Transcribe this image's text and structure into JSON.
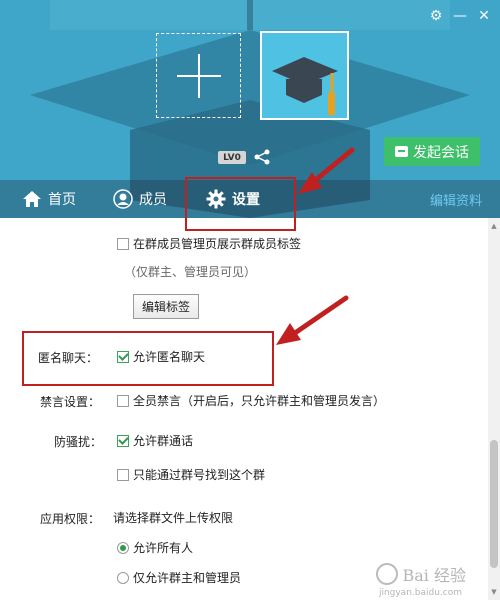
{
  "header": {
    "level_badge": "LV0",
    "start_chat_label": "发起会话",
    "colors": {
      "background": "#3fa6c9",
      "start_chat": "#3ec06a"
    }
  },
  "tabs": [
    {
      "label": "首页",
      "icon": "home-icon"
    },
    {
      "label": "成员",
      "icon": "user-icon"
    },
    {
      "label": "设置",
      "icon": "gear-icon",
      "active": true
    }
  ],
  "edit_profile_label": "编辑资料",
  "settings": {
    "show_member_tag_label": "在群成员管理页展示群成员标签",
    "show_member_tag_checked": false,
    "visibility_hint": "（仅群主、管理员可见）",
    "edit_tag_button": "编辑标签",
    "anonymous": {
      "label": "匿名聊天：",
      "option": "允许匿名聊天",
      "checked": true
    },
    "mute": {
      "label": "禁言设置：",
      "option": "全员禁言（开启后，只允许群主和管理员发言）",
      "checked": false
    },
    "anti_harass": {
      "label": "防骚扰：",
      "option1": "允许群通话",
      "option1_checked": true,
      "option2": "只能通过群号找到这个群",
      "option2_checked": false
    },
    "app_permission": {
      "label": "应用权限：",
      "description": "请选择群文件上传权限",
      "radio1": "允许所有人",
      "radio1_checked": true,
      "radio2": "仅允许群主和管理员",
      "radio2_checked": false
    }
  },
  "annotation_color": "#c0201f",
  "watermark": {
    "text": "Bai 经验",
    "sub": "jingyan.baidu.com"
  }
}
